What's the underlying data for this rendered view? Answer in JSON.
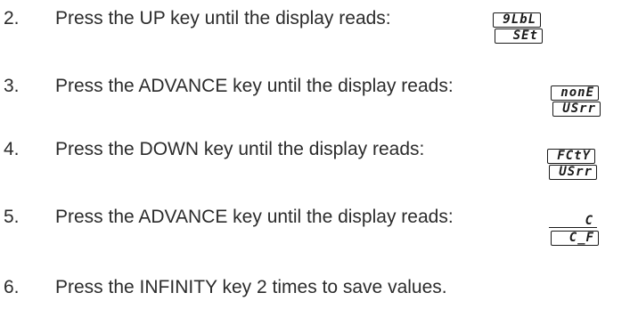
{
  "steps": [
    {
      "number": "2.",
      "text": "Press the UP key until the display reads:",
      "display": {
        "top": "9LbL",
        "bottom": "SEt"
      }
    },
    {
      "number": "3.",
      "text": "Press the ADVANCE key until the display reads:",
      "display": {
        "top": "nonE",
        "bottom": "USrr"
      }
    },
    {
      "number": "4.",
      "text": "Press the DOWN key until the display reads:",
      "display": {
        "top": "FCtY",
        "bottom": "USrr"
      }
    },
    {
      "number": "5.",
      "text": "Press the ADVANCE key until the display reads:",
      "display": {
        "top": "C",
        "bottom": "C_F"
      }
    },
    {
      "number": "6.",
      "text": "Press the INFINITY key 2 times to save values."
    }
  ]
}
